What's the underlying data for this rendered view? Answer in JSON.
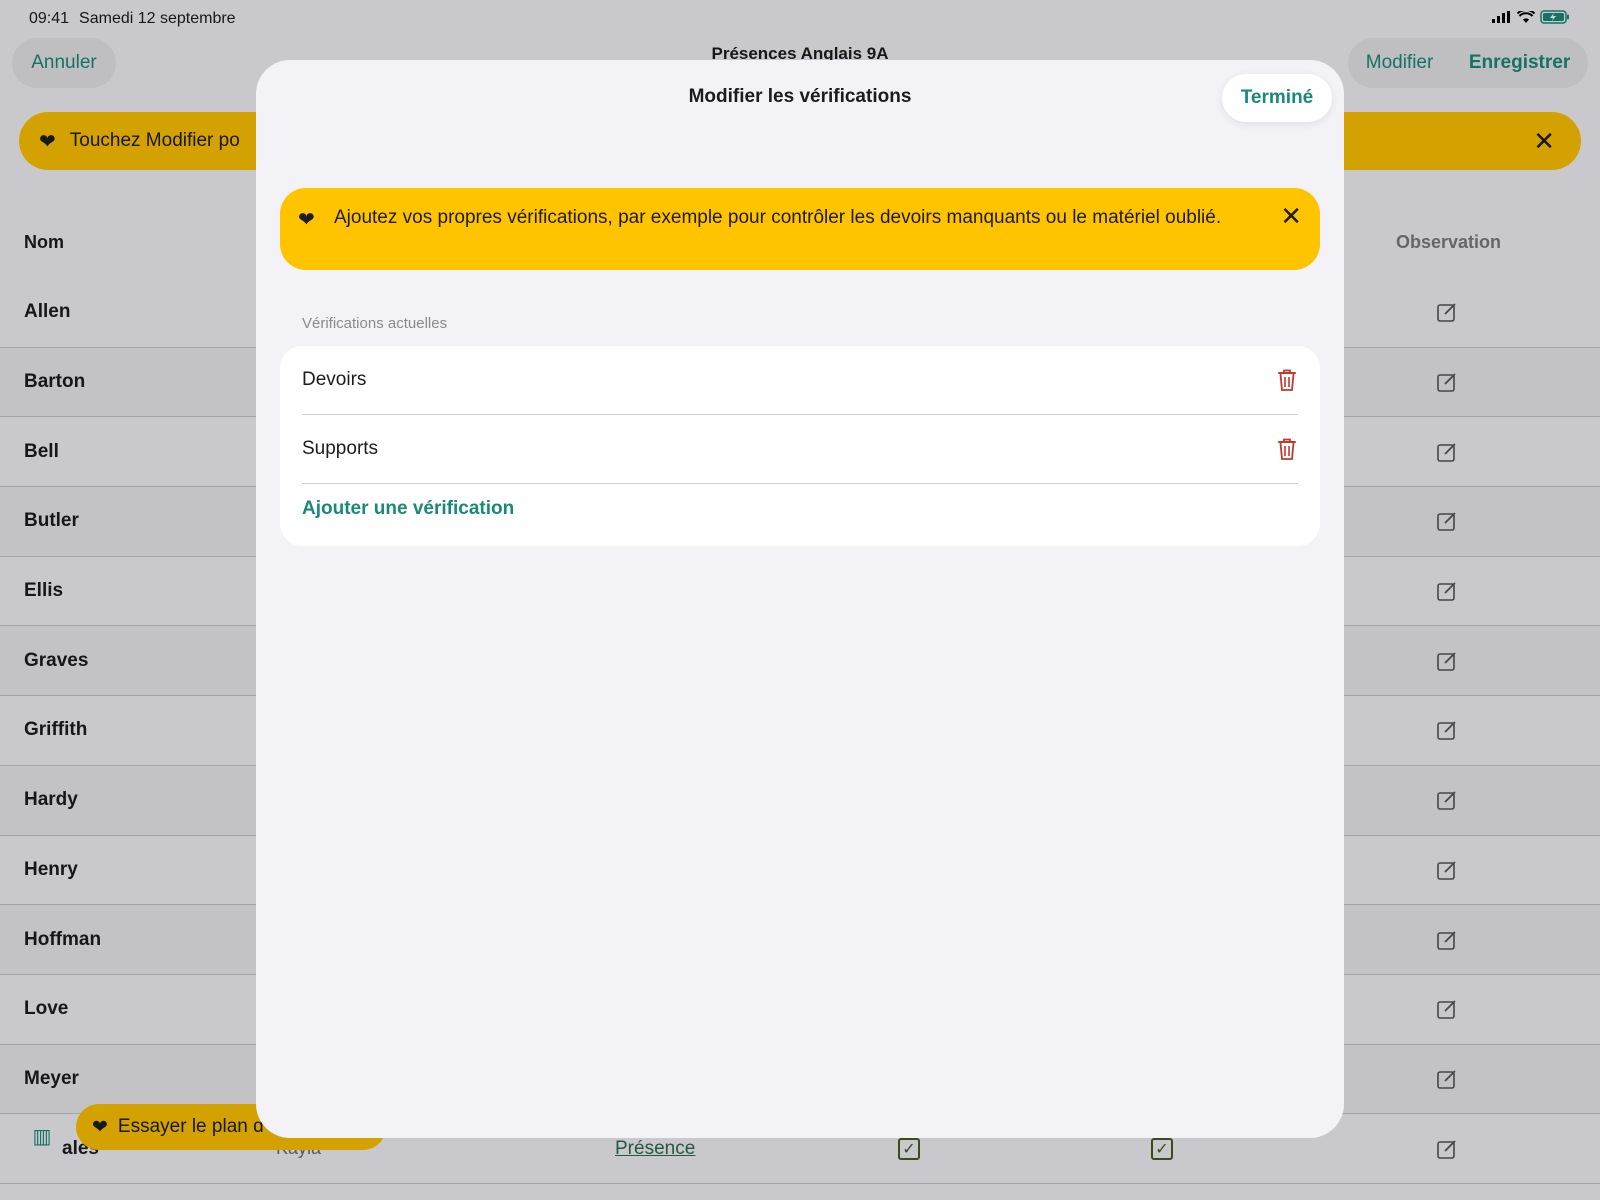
{
  "status_bar": {
    "time": "09:41",
    "date": "Samedi 12 septembre"
  },
  "nav": {
    "title": "Présences Anglais 9A",
    "cancel_label": "Annuler",
    "modify_label": "Modifier",
    "save_label": "Enregistrer"
  },
  "tip_banner": {
    "text": "Touchez Modifier po"
  },
  "table": {
    "columns": {
      "name": "Nom",
      "observation": "Observation"
    },
    "rows": [
      {
        "name": "Allen"
      },
      {
        "name": "Barton"
      },
      {
        "name": "Bell"
      },
      {
        "name": "Butler"
      },
      {
        "name": "Ellis"
      },
      {
        "name": "Graves"
      },
      {
        "name": "Griffith"
      },
      {
        "name": "Hardy"
      },
      {
        "name": "Henry"
      },
      {
        "name": "Hoffman"
      },
      {
        "name": "Love"
      },
      {
        "name": "Meyer"
      },
      {
        "name": "ales",
        "first_name": "Kayla",
        "presence": "Présence"
      }
    ]
  },
  "try_banner": {
    "text": "Essayer le plan d"
  },
  "sheet": {
    "title": "Modifier les vérifications",
    "done_label": "Terminé",
    "info_text": "Ajoutez vos propres vérifications, par exemple pour contrôler les devoirs manquants ou le matériel oublié.",
    "section_label": "Vérifications actuelles",
    "checks": [
      {
        "label": "Devoirs"
      },
      {
        "label": "Supports"
      }
    ],
    "add_label": "Ajouter une vérification"
  },
  "colors": {
    "accent": "#1a8a78",
    "banner": "#ffc300",
    "trash": "#c0392b"
  }
}
